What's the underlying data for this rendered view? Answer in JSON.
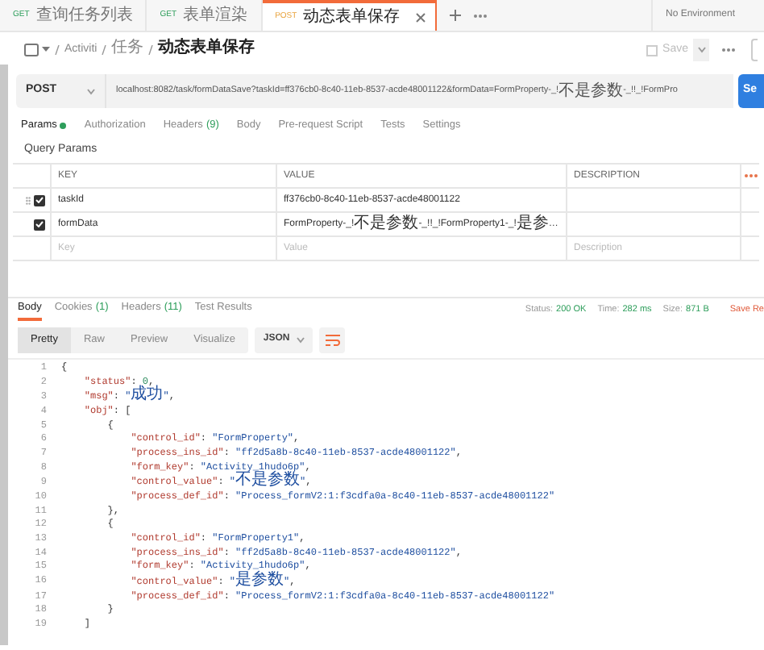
{
  "tabs": [
    {
      "method": "GET",
      "title": "查询任务列表",
      "selected": false
    },
    {
      "method": "GET",
      "title": "表单渲染",
      "selected": false
    },
    {
      "method": "POST",
      "title": "动态表单保存",
      "selected": true
    }
  ],
  "environment": "No Environment",
  "breadcrumb": [
    "Activiti",
    "任务",
    "动态表单保存"
  ],
  "save_label": "Save",
  "request": {
    "method": "POST",
    "url": "localhost:8082/task/formDataSave?taskId=ff376cb0-8c40-11eb-8537-acde48001122&formData=FormProperty-_!不是参数-_!!_!FormPro",
    "send_label": "Se"
  },
  "request_tabs": [
    {
      "label": "Params",
      "selected": true,
      "dot": true
    },
    {
      "label": "Authorization",
      "selected": false
    },
    {
      "label": "Headers",
      "count": "(9)",
      "selected": false
    },
    {
      "label": "Body",
      "selected": false
    },
    {
      "label": "Pre-request Script",
      "selected": false
    },
    {
      "label": "Tests",
      "selected": false
    },
    {
      "label": "Settings",
      "selected": false
    }
  ],
  "query_params_title": "Query Params",
  "params_table": {
    "columns": [
      "KEY",
      "VALUE",
      "DESCRIPTION"
    ],
    "rows": [
      {
        "key": "taskId",
        "value": "ff376cb0-8c40-11eb-8537-acde48001122",
        "checked": true
      },
      {
        "key": "formData",
        "value": "FormProperty-_!不是参数-_!!_!FormProperty1-_!是参…",
        "checked": true
      }
    ],
    "placeholders": {
      "key": "Key",
      "value": "Value",
      "description": "Description"
    }
  },
  "response_tabs": [
    {
      "label": "Body",
      "selected": true
    },
    {
      "label": "Cookies",
      "count": "(1)",
      "selected": false
    },
    {
      "label": "Headers",
      "count": "(11)",
      "selected": false
    },
    {
      "label": "Test Results",
      "selected": false
    }
  ],
  "response_stats": [
    {
      "label": "Status:",
      "value": "200 OK"
    },
    {
      "label": "Time:",
      "value": "282 ms"
    },
    {
      "label": "Size:",
      "value": "871 B"
    }
  ],
  "save_response": "Save Re",
  "view_modes": [
    {
      "label": "Pretty",
      "selected": true
    },
    {
      "label": "Raw",
      "selected": false
    },
    {
      "label": "Preview",
      "selected": false
    },
    {
      "label": "Visualize",
      "selected": false
    }
  ],
  "format": "JSON",
  "code_lines": [
    {
      "number": "1",
      "tokens": [
        {
          "kind": "punct",
          "text": "{"
        }
      ]
    },
    {
      "number": "2",
      "tokens": [
        {
          "kind": "key",
          "text": "    \"status\""
        },
        {
          "kind": "punct",
          "text": ": "
        },
        {
          "kind": "number",
          "text": "0"
        },
        {
          "kind": "punct",
          "text": ","
        }
      ]
    },
    {
      "number": "3",
      "tokens": [
        {
          "kind": "key",
          "text": "    \"msg\""
        },
        {
          "kind": "punct",
          "text": ": "
        },
        {
          "kind": "string",
          "text": "\"成功\""
        },
        {
          "kind": "punct",
          "text": ","
        }
      ]
    },
    {
      "number": "4",
      "tokens": [
        {
          "kind": "key",
          "text": "    \"obj\""
        },
        {
          "kind": "punct",
          "text": ": ["
        }
      ]
    },
    {
      "number": "5",
      "tokens": [
        {
          "kind": "punct",
          "text": "        {"
        }
      ]
    },
    {
      "number": "6",
      "tokens": [
        {
          "kind": "key",
          "text": "            \"control_id\""
        },
        {
          "kind": "punct",
          "text": ": "
        },
        {
          "kind": "string",
          "text": "\"FormProperty\""
        },
        {
          "kind": "punct",
          "text": ","
        }
      ]
    },
    {
      "number": "7",
      "tokens": [
        {
          "kind": "key",
          "text": "            \"process_ins_id\""
        },
        {
          "kind": "punct",
          "text": ": "
        },
        {
          "kind": "string",
          "text": "\"ff2d5a8b-8c40-11eb-8537-acde48001122\""
        },
        {
          "kind": "punct",
          "text": ","
        }
      ]
    },
    {
      "number": "8",
      "tokens": [
        {
          "kind": "key",
          "text": "            \"form_key\""
        },
        {
          "kind": "punct",
          "text": ": "
        },
        {
          "kind": "string",
          "text": "\"Activity_1hudo6p\""
        },
        {
          "kind": "punct",
          "text": ","
        }
      ]
    },
    {
      "number": "9",
      "tokens": [
        {
          "kind": "key",
          "text": "            \"control_value\""
        },
        {
          "kind": "punct",
          "text": ": "
        },
        {
          "kind": "string",
          "text": "\"不是参数\""
        },
        {
          "kind": "punct",
          "text": ","
        }
      ]
    },
    {
      "number": "10",
      "tokens": [
        {
          "kind": "key",
          "text": "            \"process_def_id\""
        },
        {
          "kind": "punct",
          "text": ": "
        },
        {
          "kind": "string",
          "text": "\"Process_formV2:1:f3cdfa0a-8c40-11eb-8537-acde48001122\""
        }
      ]
    },
    {
      "number": "11",
      "tokens": [
        {
          "kind": "punct",
          "text": "        },"
        }
      ]
    },
    {
      "number": "12",
      "tokens": [
        {
          "kind": "punct",
          "text": "        {"
        }
      ]
    },
    {
      "number": "13",
      "tokens": [
        {
          "kind": "key",
          "text": "            \"control_id\""
        },
        {
          "kind": "punct",
          "text": ": "
        },
        {
          "kind": "string",
          "text": "\"FormProperty1\""
        },
        {
          "kind": "punct",
          "text": ","
        }
      ]
    },
    {
      "number": "14",
      "tokens": [
        {
          "kind": "key",
          "text": "            \"process_ins_id\""
        },
        {
          "kind": "punct",
          "text": ": "
        },
        {
          "kind": "string",
          "text": "\"ff2d5a8b-8c40-11eb-8537-acde48001122\""
        },
        {
          "kind": "punct",
          "text": ","
        }
      ]
    },
    {
      "number": "15",
      "tokens": [
        {
          "kind": "key",
          "text": "            \"form_key\""
        },
        {
          "kind": "punct",
          "text": ": "
        },
        {
          "kind": "string",
          "text": "\"Activity_1hudo6p\""
        },
        {
          "kind": "punct",
          "text": ","
        }
      ]
    },
    {
      "number": "16",
      "tokens": [
        {
          "kind": "key",
          "text": "            \"control_value\""
        },
        {
          "kind": "punct",
          "text": ": "
        },
        {
          "kind": "string",
          "text": "\"是参数\""
        },
        {
          "kind": "punct",
          "text": ","
        }
      ]
    },
    {
      "number": "17",
      "tokens": [
        {
          "kind": "key",
          "text": "            \"process_def_id\""
        },
        {
          "kind": "punct",
          "text": ": "
        },
        {
          "kind": "string",
          "text": "\"Process_formV2:1:f3cdfa0a-8c40-11eb-8537-acde48001122\""
        }
      ]
    },
    {
      "number": "18",
      "tokens": [
        {
          "kind": "punct",
          "text": "        }"
        }
      ]
    },
    {
      "number": "19",
      "tokens": [
        {
          "kind": "punct",
          "text": "    ]"
        }
      ]
    }
  ]
}
